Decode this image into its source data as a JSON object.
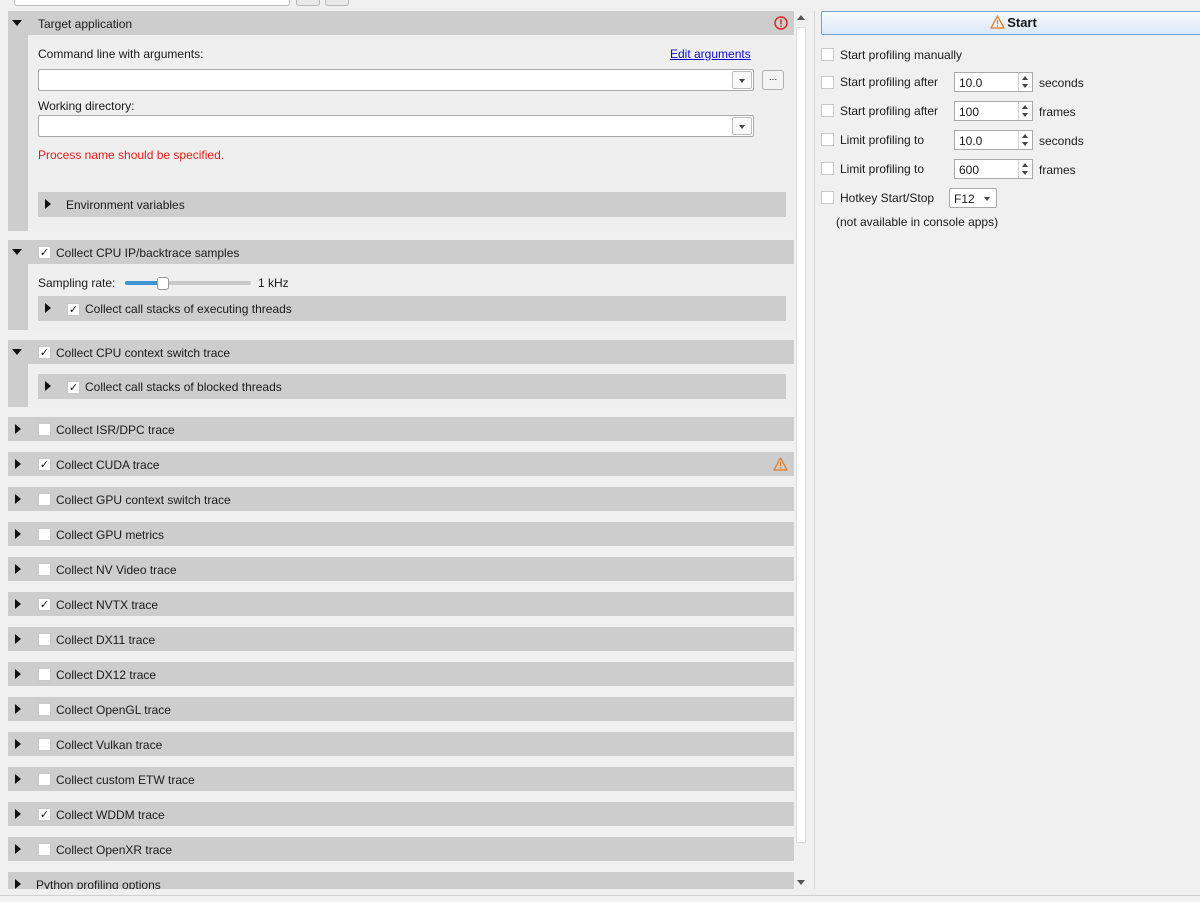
{
  "target_section": {
    "title": "Target application",
    "command_label": "Command line with arguments:",
    "edit_arguments": "Edit arguments",
    "browse_label": "...",
    "working_dir_label": "Working directory:",
    "error": "Process name should be specified.",
    "env_vars": "Environment variables"
  },
  "cpu_samples": {
    "title": "Collect CPU IP/backtrace samples",
    "checked": true,
    "sampling_label": "Sampling rate:",
    "sampling_value": "1 kHz",
    "sampling_level": 0.3,
    "call_stacks": "Collect call stacks of executing threads"
  },
  "context_switch": {
    "title": "Collect CPU context switch trace",
    "checked": true,
    "call_stacks": "Collect call stacks of blocked threads"
  },
  "collapsed_sections": [
    {
      "label": "Collect ISR/DPC trace",
      "checked": false
    },
    {
      "label": "Collect CUDA trace",
      "checked": true,
      "warning": true
    },
    {
      "label": "Collect GPU context switch trace",
      "checked": false
    },
    {
      "label": "Collect GPU metrics",
      "checked": false
    },
    {
      "label": "Collect NV Video trace",
      "checked": false
    },
    {
      "label": "Collect NVTX trace",
      "checked": true
    },
    {
      "label": "Collect DX11 trace",
      "checked": false
    },
    {
      "label": "Collect DX12 trace",
      "checked": false
    },
    {
      "label": "Collect OpenGL trace",
      "checked": false
    },
    {
      "label": "Collect Vulkan trace",
      "checked": false
    },
    {
      "label": "Collect custom ETW trace",
      "checked": false
    },
    {
      "label": "Collect WDDM trace",
      "checked": true
    },
    {
      "label": "Collect OpenXR trace",
      "checked": false
    }
  ],
  "python_section": "Python profiling options",
  "right": {
    "start_label": "Start",
    "manual": "Start profiling manually",
    "after_seconds_label": "Start profiling after",
    "after_seconds_value": "10.0",
    "seconds_unit": "seconds",
    "after_frames_label": "Start profiling after",
    "after_frames_value": "100",
    "frames_unit": "frames",
    "limit_seconds_label": "Limit profiling to",
    "limit_seconds_value": "10.0",
    "limit_frames_label": "Limit profiling to",
    "limit_frames_value": "600",
    "hotkey_label": "Hotkey Start/Stop",
    "hotkey_value": "F12",
    "hotkey_note": "(not available in console apps)"
  },
  "colors": {
    "error": "#e0201c",
    "warning": "#e8771e",
    "link": "#0a0acc",
    "accent": "#3c93d5"
  }
}
